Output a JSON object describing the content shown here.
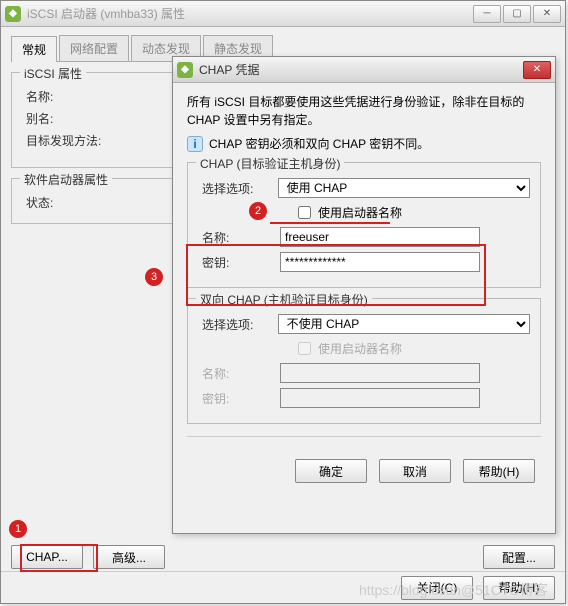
{
  "parent_window": {
    "title": "iSCSI 启动器 (vmhba33) 属性",
    "tabs": [
      "常规",
      "网络配置",
      "动态发现",
      "静态发现"
    ],
    "active_tab_index": 0,
    "group_iscsi": {
      "legend": "iSCSI 属性",
      "rows": {
        "name": "名称:",
        "alias": "别名:",
        "discovery": "目标发现方法:"
      }
    },
    "group_software": {
      "legend": "软件启动器属性",
      "rows": {
        "status": "状态:"
      }
    },
    "bottom_buttons": {
      "chap": "CHAP...",
      "advanced": "高级...",
      "configure": "配置..."
    },
    "footer_buttons": {
      "close": "关闭(C)",
      "help": "帮助(H)"
    }
  },
  "chap_dialog": {
    "title": "CHAP 凭据",
    "intro": "所有 iSCSI 目标都要使用这些凭据进行身份验证，除非在目标的 CHAP 设置中另有指定。",
    "hint": "CHAP 密钥必须和双向 CHAP 密钥不同。",
    "chap_group": {
      "legend": "CHAP (目标验证主机身份)",
      "select_label": "选择选项:",
      "select_value": "使用 CHAP",
      "use_initiator_label": "使用启动器名称",
      "use_initiator_checked": false,
      "name_label": "名称:",
      "name_value": "freeuser",
      "secret_label": "密钥:",
      "secret_value": "*************"
    },
    "mutual_group": {
      "legend": "双向 CHAP (主机验证目标身份)",
      "select_label": "选择选项:",
      "select_value": "不使用 CHAP",
      "use_initiator_label": "使用启动器名称",
      "name_label": "名称:",
      "secret_label": "密钥:"
    },
    "buttons": {
      "ok": "确定",
      "cancel": "取消",
      "help": "帮助(H)"
    }
  },
  "annotations": {
    "marker1": "1",
    "marker2": "2",
    "marker3": "3"
  },
  "watermark": "https://blog.csdn@51CTO博客"
}
